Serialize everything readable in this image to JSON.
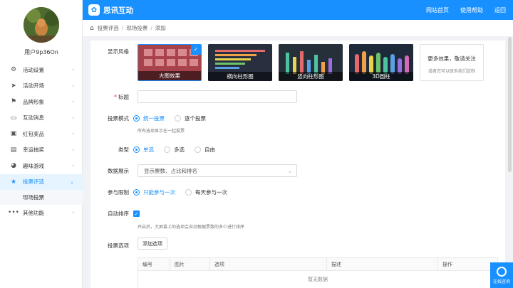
{
  "sidebar": {
    "username": "用户9p36On",
    "items": [
      {
        "icon": "gear-icon",
        "label": "活动设置"
      },
      {
        "icon": "paper-plane-icon",
        "label": "活动开场"
      },
      {
        "icon": "flag-icon",
        "label": "品牌形象"
      },
      {
        "icon": "message-icon",
        "label": "互动消息"
      },
      {
        "icon": "gift-icon",
        "label": "红包奖品"
      },
      {
        "icon": "lottery-icon",
        "label": "幸运抽奖"
      },
      {
        "icon": "game-icon",
        "label": "趣味游戏"
      },
      {
        "icon": "star-icon",
        "label": "投票评选"
      },
      {
        "icon": "more-icon",
        "label": "其他功能"
      }
    ],
    "sub_item": "现场投票"
  },
  "header": {
    "brand": "思讯互动",
    "links": [
      "网站首页",
      "使用帮助",
      "返回"
    ]
  },
  "breadcrumb": {
    "items": [
      "投票评选",
      "现场投票",
      "添加"
    ]
  },
  "form": {
    "display_style": {
      "label": "显示风格",
      "cards": [
        "大图效果",
        "横向柱形图",
        "竖向柱形图",
        "3D圆柱"
      ],
      "more_title": "更多效果，敬请关注",
      "more_sub": "或者您可以联系我们定制"
    },
    "title": {
      "label": "标题",
      "value": ""
    },
    "vote_mode": {
      "label": "投票模式",
      "options": [
        "统一投票",
        "逐个投票"
      ],
      "hint": "所有选项显示在一起投票"
    },
    "type": {
      "label": "类型",
      "options": [
        "单选",
        "多选",
        "自由"
      ]
    },
    "data_display": {
      "label": "数据展示",
      "value": "显示票数、占比和排名"
    },
    "participation": {
      "label": "参与限制",
      "options": [
        "只能参与一次",
        "每天参与一次"
      ]
    },
    "auto_sort": {
      "label": "自动排序",
      "hint": "开启后，大屏幕上的选项会自动根据票数的多少进行排序"
    },
    "vote_options": {
      "label": "投票选项",
      "add_button": "添加选项",
      "columns": [
        "编号",
        "图片",
        "选项",
        "描述",
        "操作"
      ],
      "empty": "暂无数据"
    }
  },
  "float_button": "在线咨询",
  "colors": {
    "primary": "#1890ff"
  }
}
